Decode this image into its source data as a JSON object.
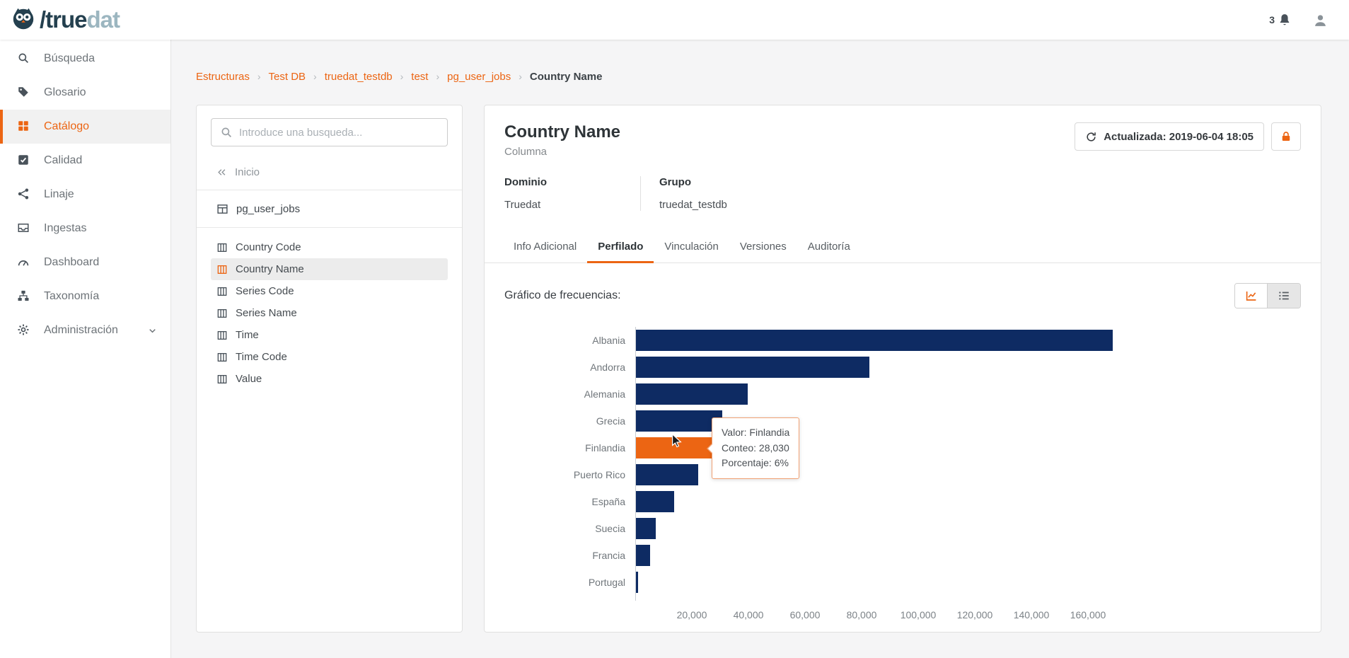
{
  "header": {
    "logo_slash": "/",
    "logo_bold": "true",
    "logo_light": "dat",
    "notification_count": "3"
  },
  "sidebar": {
    "items": [
      {
        "label": "Búsqueda",
        "icon": "search",
        "active": false
      },
      {
        "label": "Glosario",
        "icon": "tag",
        "active": false
      },
      {
        "label": "Catálogo",
        "icon": "grid",
        "active": true
      },
      {
        "label": "Calidad",
        "icon": "check",
        "active": false
      },
      {
        "label": "Linaje",
        "icon": "share",
        "active": false
      },
      {
        "label": "Ingestas",
        "icon": "inbox",
        "active": false
      },
      {
        "label": "Dashboard",
        "icon": "dashboard",
        "active": false
      },
      {
        "label": "Taxonomía",
        "icon": "sitemap",
        "active": false
      },
      {
        "label": "Administración",
        "icon": "gear",
        "active": false,
        "has_chevron": true
      }
    ]
  },
  "breadcrumb": {
    "links": [
      "Estructuras",
      "Test DB",
      "truedat_testdb",
      "test",
      "pg_user_jobs"
    ],
    "current": "Country Name"
  },
  "panel": {
    "search_placeholder": "Introduce una busqueda...",
    "back_label": "Inicio",
    "table_name": "pg_user_jobs",
    "columns": [
      "Country Code",
      "Country Name",
      "Series Code",
      "Series Name",
      "Time",
      "Time Code",
      "Value"
    ],
    "active_column": "Country Name"
  },
  "main": {
    "title": "Country Name",
    "subtitle": "Columna",
    "updated_label": "Actualizada: 2019-06-04 18:05",
    "dominio_label": "Dominio",
    "dominio_value": "Truedat",
    "grupo_label": "Grupo",
    "grupo_value": "truedat_testdb",
    "tabs": [
      "Info Adicional",
      "Perfilado",
      "Vinculación",
      "Versiones",
      "Auditoría"
    ],
    "active_tab": "Perfilado",
    "chart_heading": "Gráfico de frecuencias:"
  },
  "tooltip": {
    "valor": "Valor: Finlandia",
    "conteo": "Conteo: 28,030",
    "porcentaje": "Porcentaje: 6%"
  },
  "chart_data": {
    "type": "bar",
    "orientation": "horizontal",
    "title": "Gráfico de frecuencias",
    "categories": [
      "Albania",
      "Andorra",
      "Alemania",
      "Grecia",
      "Finlandia",
      "Puerto Rico",
      "España",
      "Suecia",
      "Francia",
      "Portugal"
    ],
    "values": [
      168500,
      82500,
      39500,
      30500,
      28030,
      22000,
      13500,
      7000,
      5000,
      600
    ],
    "highlight_index": 4,
    "highlight_tooltip": {
      "valor": "Finlandia",
      "conteo": 28030,
      "porcentaje": "6%"
    },
    "xlim": [
      0,
      175000
    ],
    "x_tick_values": [
      20000,
      40000,
      60000,
      80000,
      100000,
      120000,
      140000,
      160000
    ],
    "x_tick_labels": [
      "20,000",
      "40,000",
      "60,000",
      "80,000",
      "100,000",
      "120,000",
      "140,000",
      "160,000"
    ],
    "bar_color": "#0e2b63",
    "highlight_color": "#ec6513",
    "legend": false,
    "grid": false
  }
}
